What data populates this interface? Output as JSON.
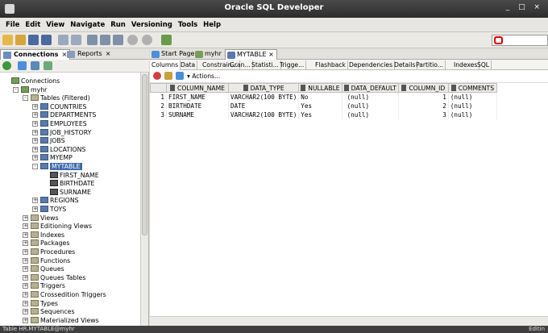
{
  "window": {
    "title": "Oracle SQL Developer",
    "controls": "_ □ ×"
  },
  "menu": [
    "File",
    "Edit",
    "View",
    "Navigate",
    "Run",
    "Versioning",
    "Tools",
    "Help"
  ],
  "left_tabs": [
    {
      "label": "Connections",
      "close": "×"
    },
    {
      "label": "Reports",
      "close": "×"
    }
  ],
  "tree": [
    {
      "label": "Connections",
      "icon": "connections-icon",
      "depth": 0,
      "expander": ""
    },
    {
      "label": "myhr",
      "icon": "database-icon",
      "depth": 1,
      "expander": "-"
    },
    {
      "label": "Tables (Filtered)",
      "icon": "folder-icon",
      "depth": 2,
      "expander": "-"
    },
    {
      "label": "COUNTRIES",
      "icon": "table-icon",
      "depth": 3,
      "expander": "+"
    },
    {
      "label": "DEPARTMENTS",
      "icon": "table-icon",
      "depth": 3,
      "expander": "+"
    },
    {
      "label": "EMPLOYEES",
      "icon": "table-icon",
      "depth": 3,
      "expander": "+"
    },
    {
      "label": "JOB_HISTORY",
      "icon": "table-icon",
      "depth": 3,
      "expander": "+"
    },
    {
      "label": "JOBS",
      "icon": "table-icon",
      "depth": 3,
      "expander": "+"
    },
    {
      "label": "LOCATIONS",
      "icon": "table-icon",
      "depth": 3,
      "expander": "+"
    },
    {
      "label": "MYEMP",
      "icon": "table-icon",
      "depth": 3,
      "expander": "+"
    },
    {
      "label": "MYTABLE",
      "icon": "table-icon",
      "depth": 3,
      "expander": "-",
      "selected": true
    },
    {
      "label": "FIRST_NAME",
      "icon": "column-icon",
      "depth": 4,
      "expander": ""
    },
    {
      "label": "BIRTHDATE",
      "icon": "column-icon",
      "depth": 4,
      "expander": ""
    },
    {
      "label": "SURNAME",
      "icon": "column-icon",
      "depth": 4,
      "expander": ""
    },
    {
      "label": "REGIONS",
      "icon": "table-icon",
      "depth": 3,
      "expander": "+"
    },
    {
      "label": "TOYS",
      "icon": "table-icon",
      "depth": 3,
      "expander": "+"
    },
    {
      "label": "Views",
      "icon": "folder-icon",
      "depth": 2,
      "expander": "+"
    },
    {
      "label": "Editioning Views",
      "icon": "folder-icon",
      "depth": 2,
      "expander": "+"
    },
    {
      "label": "Indexes",
      "icon": "folder-icon",
      "depth": 2,
      "expander": "+"
    },
    {
      "label": "Packages",
      "icon": "folder-icon",
      "depth": 2,
      "expander": "+"
    },
    {
      "label": "Procedures",
      "icon": "folder-icon",
      "depth": 2,
      "expander": "+"
    },
    {
      "label": "Functions",
      "icon": "folder-icon",
      "depth": 2,
      "expander": "+"
    },
    {
      "label": "Queues",
      "icon": "folder-icon",
      "depth": 2,
      "expander": "+"
    },
    {
      "label": "Queues Tables",
      "icon": "folder-icon",
      "depth": 2,
      "expander": "+"
    },
    {
      "label": "Triggers",
      "icon": "folder-icon",
      "depth": 2,
      "expander": "+"
    },
    {
      "label": "Crossedition Triggers",
      "icon": "folder-icon",
      "depth": 2,
      "expander": "+"
    },
    {
      "label": "Types",
      "icon": "folder-icon",
      "depth": 2,
      "expander": "+"
    },
    {
      "label": "Sequences",
      "icon": "folder-icon",
      "depth": 2,
      "expander": "+"
    },
    {
      "label": "Materialized Views",
      "icon": "folder-icon",
      "depth": 2,
      "expander": "+"
    }
  ],
  "doc_tabs": [
    {
      "label": "Start Page",
      "close": "×",
      "icon_color": "#4a8fd8"
    },
    {
      "label": "myhr",
      "close": "×",
      "icon_color": "#7a9c5a"
    },
    {
      "label": "MYTABLE",
      "close": "×",
      "icon_color": "#5a7aa8",
      "active": true
    }
  ],
  "sub_tabs": [
    "Columns",
    "Data",
    "Constrain...",
    "Gran...",
    "Statisti...",
    "Trigge...",
    "Flashback",
    "Dependencies",
    "Details",
    "Partitio...",
    "Indexes",
    "SQL"
  ],
  "actions_label": "▾ Actions...",
  "columns_grid": {
    "headers": [
      "COLUMN_NAME",
      "DATA_TYPE",
      "NULLABLE",
      "DATA_DEFAULT",
      "COLUMN_ID",
      "COMMENTS"
    ],
    "rows": [
      {
        "n": "1",
        "cells": [
          "FIRST_NAME",
          "VARCHAR2(100 BYTE)",
          "No",
          "(null)",
          "1",
          "(null)"
        ]
      },
      {
        "n": "2",
        "cells": [
          "BIRTHDATE",
          "DATE",
          "Yes",
          "(null)",
          "2",
          "(null)"
        ]
      },
      {
        "n": "3",
        "cells": [
          "SURNAME",
          "VARCHAR2(100 BYTE)",
          "Yes",
          "(null)",
          "3",
          "(null)"
        ]
      }
    ]
  },
  "status": {
    "left": "Table HR.MYTABLE@myhr",
    "right": "Editin"
  }
}
